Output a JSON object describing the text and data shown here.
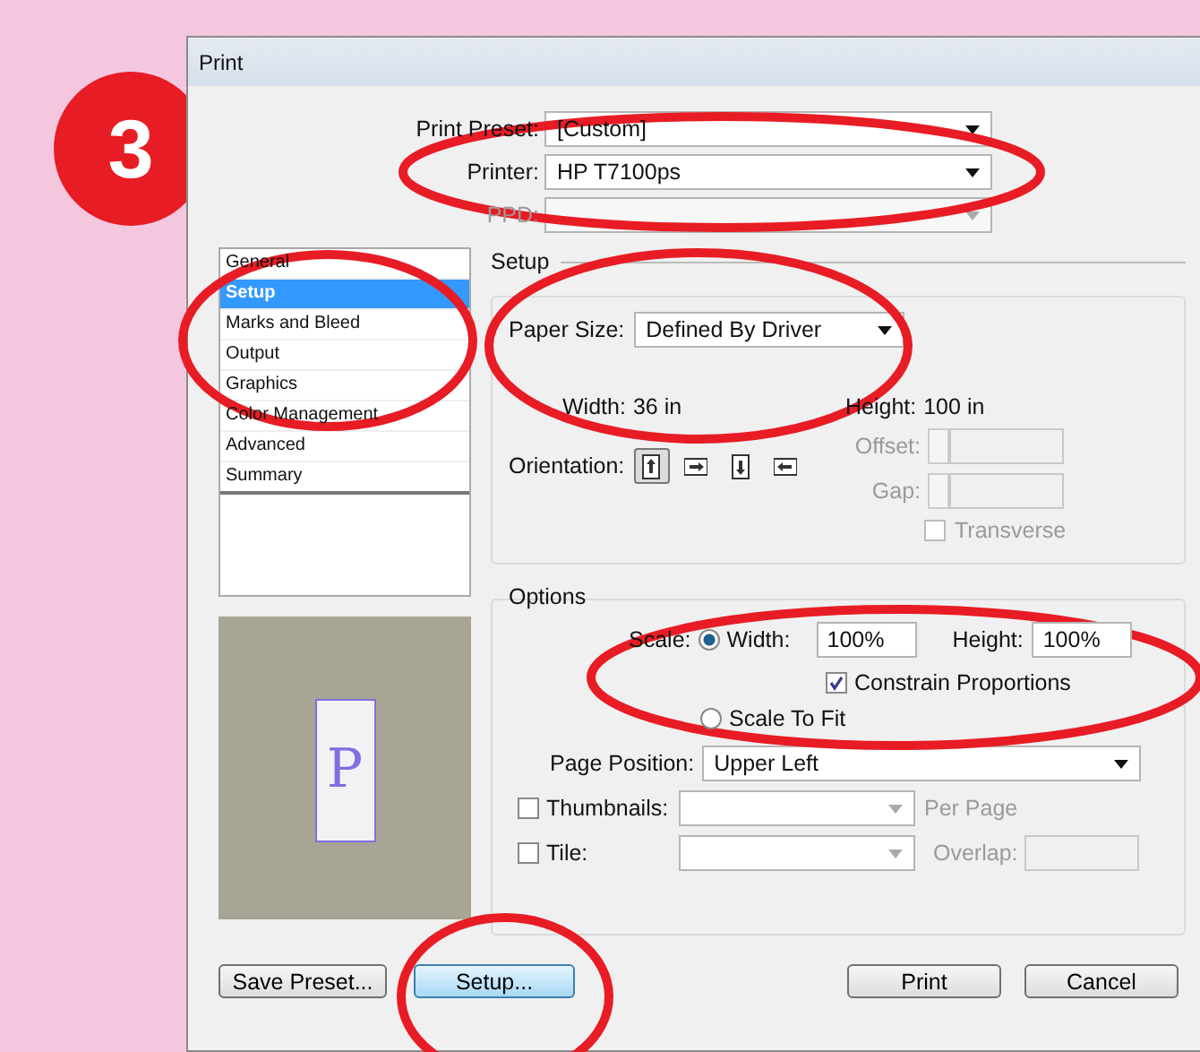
{
  "step_badge": "3",
  "window": {
    "title": "Print"
  },
  "preset": {
    "label": "Print Preset:",
    "value": "[Custom]"
  },
  "printer": {
    "label": "Printer:",
    "value": "HP T7100ps"
  },
  "ppd": {
    "label": "PPD:",
    "disabled": true
  },
  "sidebar": {
    "items": [
      {
        "label": "General",
        "selected": false
      },
      {
        "label": "Setup",
        "selected": true
      },
      {
        "label": "Marks and Bleed",
        "selected": false
      },
      {
        "label": "Output",
        "selected": false
      },
      {
        "label": "Graphics",
        "selected": false
      },
      {
        "label": "Color Management",
        "selected": false
      },
      {
        "label": "Advanced",
        "selected": false
      },
      {
        "label": "Summary",
        "selected": false
      }
    ]
  },
  "preview": {
    "letter": "P"
  },
  "setup": {
    "title": "Setup",
    "paper_size": {
      "label": "Paper Size:",
      "value": "Defined By Driver"
    },
    "width": {
      "label": "Width:",
      "value": "36 in"
    },
    "height": {
      "label": "Height:",
      "value": "100 in"
    },
    "orientation": {
      "label": "Orientation:",
      "options": [
        {
          "kind": "portrait",
          "selected": true
        },
        {
          "kind": "landscape",
          "selected": false
        },
        {
          "kind": "reverse-portrait",
          "selected": false
        },
        {
          "kind": "reverse-landscape",
          "selected": false
        }
      ]
    },
    "offset": {
      "label": "Offset:",
      "disabled": true
    },
    "gap": {
      "label": "Gap:",
      "disabled": true
    },
    "transverse": {
      "label": "Transverse",
      "checked": false,
      "disabled": true
    }
  },
  "options": {
    "title": "Options",
    "scale_label": "Scale:",
    "width_mode": {
      "label": "Width:",
      "selected": true,
      "value": "100%"
    },
    "height": {
      "label": "Height:",
      "value": "100%"
    },
    "constrain": {
      "label": "Constrain Proportions",
      "checked": true
    },
    "fit_mode": {
      "label": "Scale To Fit",
      "selected": false
    },
    "page_position": {
      "label": "Page Position:",
      "value": "Upper Left"
    },
    "thumbnails": {
      "label": "Thumbnails:",
      "checked": false,
      "suffix": "Per Page"
    },
    "tile": {
      "label": "Tile:",
      "checked": false,
      "suffix": "Overlap:"
    }
  },
  "buttons": [
    {
      "label": "Save Preset...",
      "default": false
    },
    {
      "label": "Setup...",
      "default": true
    },
    {
      "label": "Print",
      "default": false
    },
    {
      "label": "Cancel",
      "default": false
    }
  ]
}
